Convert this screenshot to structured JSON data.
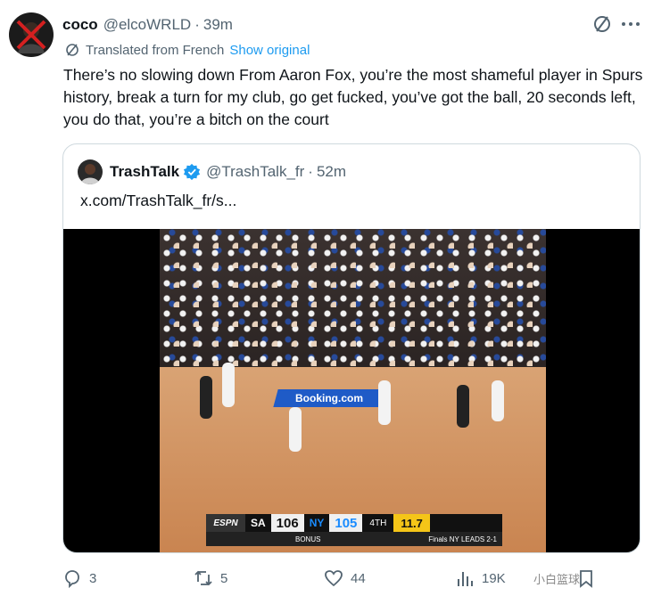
{
  "tweet": {
    "display_name": "coco",
    "handle": "@elcoWRLD",
    "separator": "·",
    "time": "39m",
    "avatar_icon": "user-avatar-crossed",
    "translation_note": "Translated from French",
    "show_original_label": "Show original",
    "text": "There’s no slowing down From Aaron Fox, you’re the most shameful player in Spurs history, break a turn for my club, go get fucked, you’ve got the ball, 20 seconds left, you do that, you’re a bitch on the court"
  },
  "quote": {
    "display_name": "TrashTalk",
    "handle": "@TrashTalk_fr",
    "separator": "·",
    "time": "52m",
    "verified_icon": "verified-badge-icon",
    "verified_color": "#1d9bf0",
    "link_text": "x.com/TrashTalk_fr/s..."
  },
  "media": {
    "ad_text": "Booking.com",
    "scoreboard": {
      "network": "ESPN",
      "team1": "SA",
      "score1": "106",
      "team2": "NY",
      "score2": "105",
      "period": "4TH",
      "clock": "11.7",
      "bonus": "BONUS",
      "finals": "Finals NY LEADS 2-1"
    }
  },
  "actions": {
    "replies": "3",
    "reposts": "5",
    "likes": "44",
    "views": "19K"
  },
  "watermark": "小白篮球",
  "colors": {
    "accent": "#1d9bf0",
    "secondary_text": "#536471",
    "border": "#cfd9de"
  }
}
